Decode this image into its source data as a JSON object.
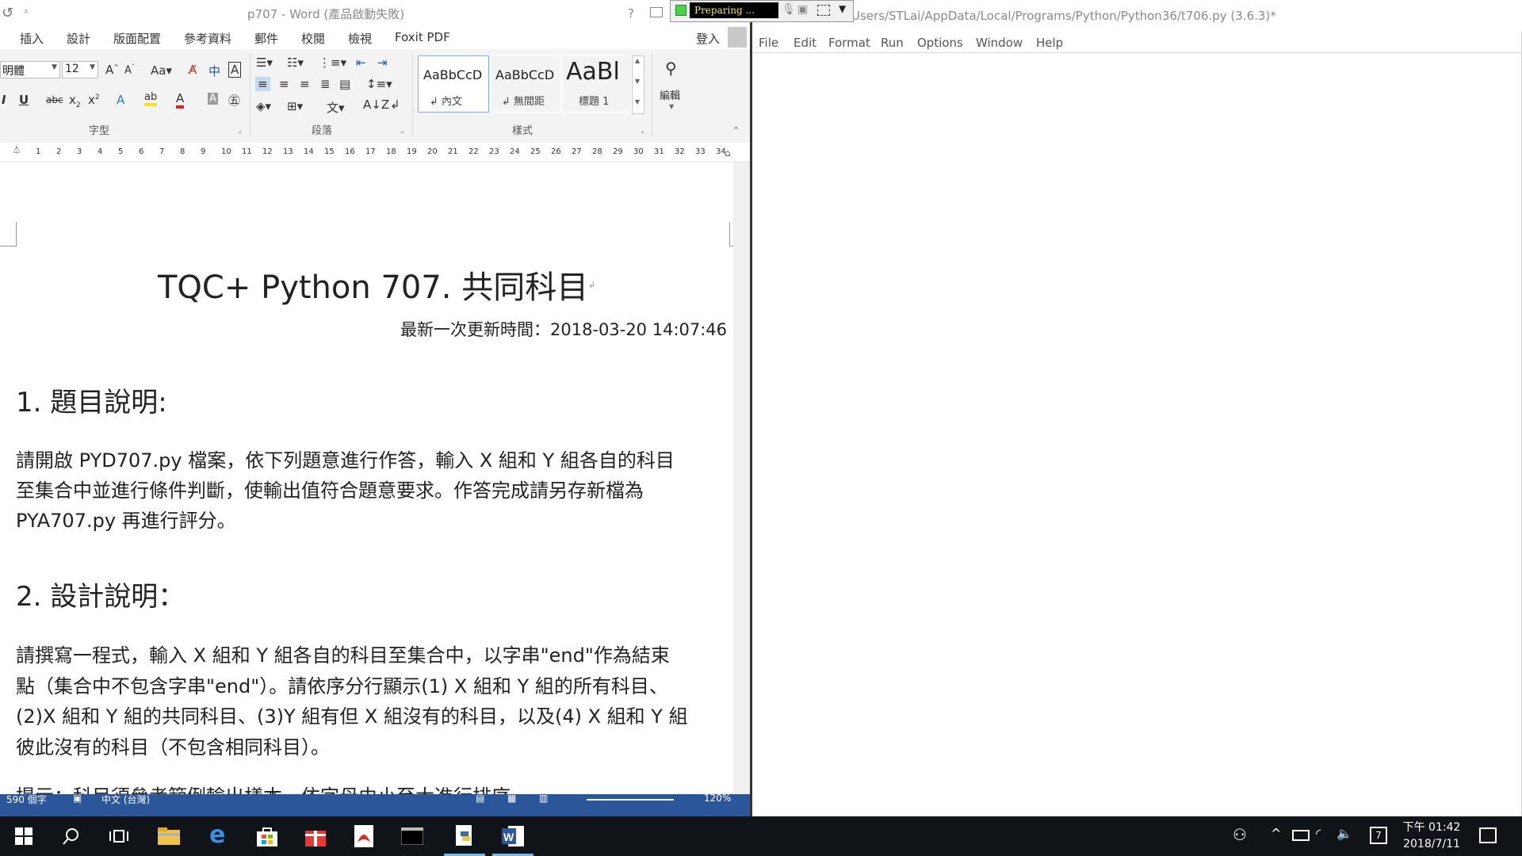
{
  "word": {
    "window_title": "p707 - Word (產品啟動失敗)",
    "help": "?",
    "tabs": [
      "插入",
      "設計",
      "版面配置",
      "參考資料",
      "郵件",
      "校閱",
      "檢視",
      "Foxit PDF"
    ],
    "sign_in": "登入",
    "font": {
      "name": "明體",
      "size": "12"
    },
    "groups": {
      "font": "字型",
      "paragraph": "段落",
      "styles": "樣式",
      "editing": "編輯"
    },
    "styles": [
      {
        "preview": "AaBbCcD",
        "label": "↲ 內文"
      },
      {
        "preview": "AaBbCcD",
        "label": "↲ 無間距"
      },
      {
        "preview": "AaBl",
        "label": "標題 1"
      }
    ],
    "ruler_numbers": [
      "1",
      "2",
      "3",
      "4",
      "5",
      "6",
      "7",
      "8",
      "9",
      "10",
      "11",
      "12",
      "13",
      "14",
      "15",
      "16",
      "17",
      "18",
      "19",
      "20",
      "21",
      "22",
      "23",
      "24",
      "25",
      "26",
      "27",
      "28",
      "29",
      "30",
      "31",
      "32",
      "33",
      "34"
    ],
    "doc": {
      "title": "TQC+ Python 707.  共同科目",
      "updated": "最新一次更新時間：2018-03-20 14:07:46",
      "h1": "1.  題目說明:",
      "p1": [
        "請開啟 PYD707.py 檔案，依下列題意進行作答，輸入 X 組和 Y 組各自的科目",
        "至集合中並進行條件判斷，使輸出值符合題意要求。作答完成請另存新檔為",
        "PYA707.py 再進行評分。"
      ],
      "h2": "2.  設計說明：",
      "p2": [
        "請撰寫一程式，輸入 X 組和 Y 組各自的科目至集合中，以字串\"end\"作為結束",
        "點（集合中不包含字串\"end\"）。請依序分行顯示(1) X 組和 Y 組的所有科目、",
        "(2)X 組和 Y 組的共同科目、(3)Y 組有但 X 組沒有的科目，以及(4) X 組和 Y 組",
        "彼此沒有的科目（不包含相同科目）。"
      ],
      "p3_partial": "提示：科目須參考範例輸出樣本，依字母由小至大進行排序。"
    },
    "status": {
      "left": "590 個字",
      "lang": "中文 (台灣)",
      "zoom": "120%"
    }
  },
  "recorder": {
    "status": "Preparing ..."
  },
  "idle": {
    "title": "Users/STLai/AppData/Local/Programs/Python/Python36/t706.py (3.6.3)*",
    "menu": [
      "File",
      "Edit",
      "Format",
      "Run",
      "Options",
      "Window",
      "Help"
    ]
  },
  "taskbar": {
    "time": "下午 01:42",
    "date": "2018/7/11",
    "notification_count": "7"
  },
  "colors": {
    "word_blue": "#2b579a",
    "taskbar": "#101418",
    "accent": "#76b9ed"
  }
}
